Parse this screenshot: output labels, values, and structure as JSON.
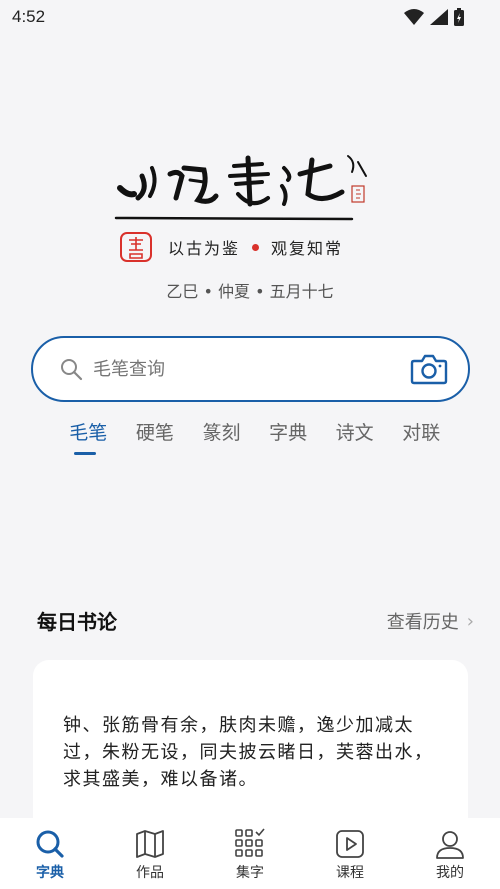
{
  "status": {
    "time": "4:52"
  },
  "header": {
    "motto_left": "以古为鉴",
    "motto_right": "观复知常",
    "lunar_date": "乙巳 • 仲夏 • 五月十七"
  },
  "search": {
    "placeholder": "毛笔查询"
  },
  "tabs": [
    {
      "label": "毛笔",
      "active": true
    },
    {
      "label": "硬笔"
    },
    {
      "label": "篆刻"
    },
    {
      "label": "字典"
    },
    {
      "label": "诗文"
    },
    {
      "label": "对联"
    }
  ],
  "daily": {
    "title": "每日书论",
    "history_label": "查看历史",
    "quote": "钟、张筋骨有余，肤肉未赡，逸少加减太过，朱粉无设，同夫披云睹日，芙蓉出水，求其盛美，难以备诸。"
  },
  "nav": [
    {
      "label": "字典",
      "icon": "search-icon",
      "active": true
    },
    {
      "label": "作品",
      "icon": "map-icon"
    },
    {
      "label": "集字",
      "icon": "grid-check-icon"
    },
    {
      "label": "课程",
      "icon": "play-icon"
    },
    {
      "label": "我的",
      "icon": "user-icon"
    }
  ],
  "colors": {
    "accent": "#1a5fa8",
    "seal_red": "#d9312b"
  }
}
